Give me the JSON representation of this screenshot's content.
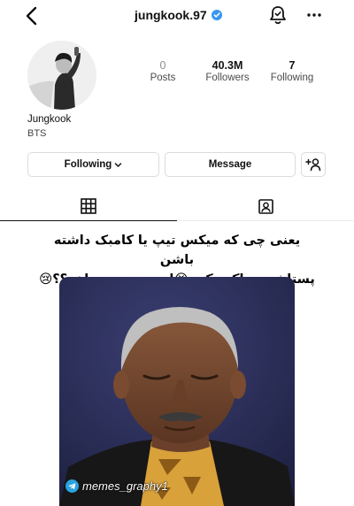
{
  "header": {
    "handle": "jungkook.97",
    "icons": {
      "back": "chevron-left-icon",
      "verified": "verified-badge-icon",
      "notifications": "bell-icon",
      "more": "more-horizontal-icon"
    },
    "accent": "#3897f0"
  },
  "profile": {
    "avatar": "profile-photo",
    "name": "Jungkook",
    "bio": "BTS",
    "stats": [
      {
        "value": "0",
        "label": "Posts"
      },
      {
        "value": "40.3M",
        "label": "Followers"
      },
      {
        "value": "7",
        "label": "Following"
      }
    ]
  },
  "actions": {
    "following_label": "Following",
    "message_label": "Message",
    "add_icon": "add-user-icon"
  },
  "tabs": [
    {
      "name": "grid",
      "icon": "grid-icon",
      "active": true
    },
    {
      "name": "tagged",
      "icon": "tagged-person-icon",
      "active": false
    }
  ],
  "post": {
    "caption_line1": "یعنی چی که میکس تیپ یا کامبک داشته باشن",
    "caption_line2": "پستاشونو پاک‌میکنن😭این چ رسمیه اخه؟؟😢",
    "watermark": "memes_graphy1",
    "watermark_icon": "telegram-icon"
  }
}
